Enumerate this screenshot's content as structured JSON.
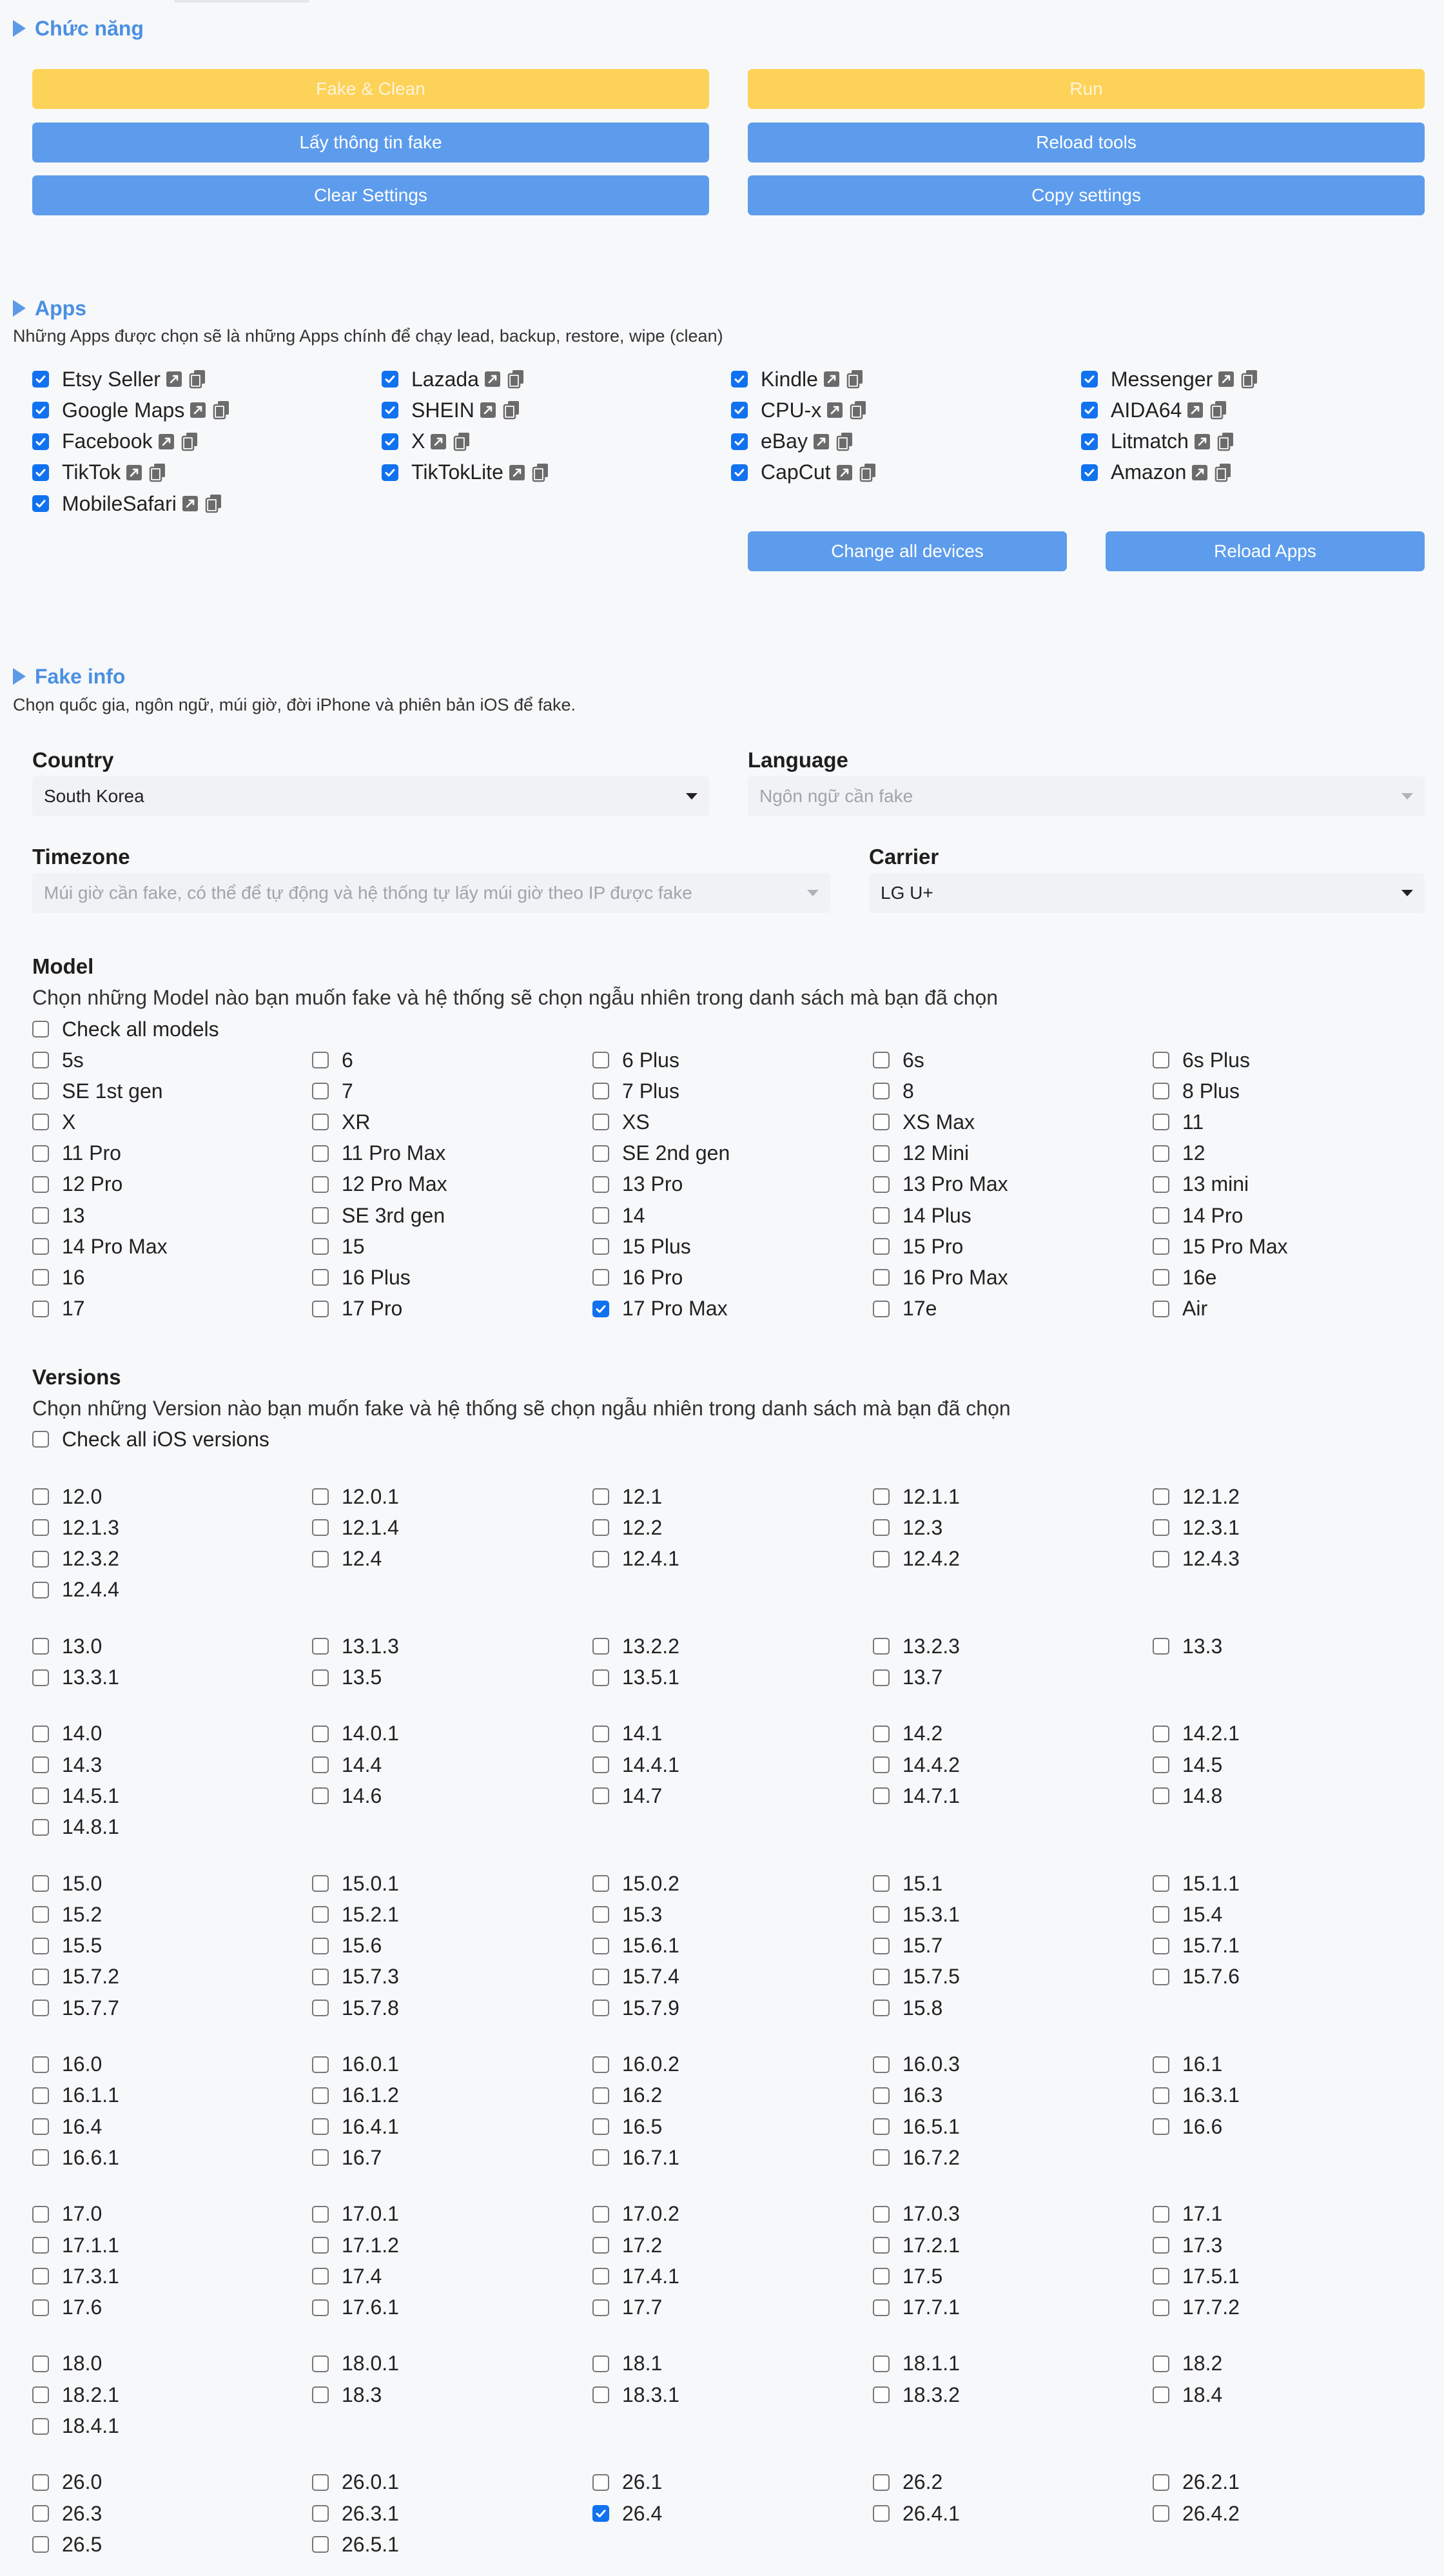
{
  "sections": {
    "functions": {
      "title": "Chức năng"
    },
    "apps": {
      "title": "Apps",
      "description": "Những Apps được chọn sẽ là những Apps chính để chạy lead, backup, restore, wipe (clean)"
    },
    "fake_info": {
      "title": "Fake info",
      "description": "Chọn quốc gia, ngôn ngữ, múi giờ, đời iPhone và phiên bản iOS để fake."
    }
  },
  "function_buttons": [
    [
      "Fake & Clean",
      "Run"
    ],
    [
      "Lấy thông tin fake",
      "Reload tools"
    ],
    [
      "Clear Settings",
      "Copy settings"
    ]
  ],
  "apps": [
    [
      {
        "name": "Etsy Seller",
        "checked": true
      },
      {
        "name": "Lazada",
        "checked": true
      },
      {
        "name": "Kindle",
        "checked": true
      },
      {
        "name": "Messenger",
        "checked": true
      }
    ],
    [
      {
        "name": "Google Maps",
        "checked": true
      },
      {
        "name": "SHEIN",
        "checked": true
      },
      {
        "name": "CPU-x",
        "checked": true
      },
      {
        "name": "AIDA64",
        "checked": true
      }
    ],
    [
      {
        "name": "Facebook",
        "checked": true
      },
      {
        "name": "X",
        "checked": true
      },
      {
        "name": "eBay",
        "checked": true
      },
      {
        "name": "Litmatch",
        "checked": true
      }
    ],
    [
      {
        "name": "TikTok",
        "checked": true
      },
      {
        "name": "TikTokLite",
        "checked": true
      },
      {
        "name": "CapCut",
        "checked": true
      },
      {
        "name": "Amazon",
        "checked": true
      }
    ],
    [
      {
        "name": "MobileSafari",
        "checked": true
      }
    ]
  ],
  "app_buttons": {
    "change_all": "Change all devices",
    "reload": "Reload Apps"
  },
  "fields": {
    "country": {
      "label": "Country",
      "value": "South Korea"
    },
    "language": {
      "label": "Language",
      "placeholder": "Ngôn ngữ cần fake"
    },
    "timezone": {
      "label": "Timezone",
      "placeholder": "Múi giờ cần fake, có thể để tự động và hệ thống tự lấy múi giờ theo IP được fake"
    },
    "carrier": {
      "label": "Carrier",
      "value": "LG U+"
    }
  },
  "models": {
    "title": "Model",
    "description": "Chọn những Model nào bạn muốn fake và hệ thống sẽ chọn ngẫu nhiên trong danh sách mà bạn đã chọn",
    "check_all": "Check all models",
    "items": [
      [
        "5s",
        "6",
        "6 Plus",
        "6s",
        "6s Plus"
      ],
      [
        "SE 1st gen",
        "7",
        "7 Plus",
        "8",
        "8 Plus"
      ],
      [
        "X",
        "XR",
        "XS",
        "XS Max",
        "11"
      ],
      [
        "11 Pro",
        "11 Pro Max",
        "SE 2nd gen",
        "12 Mini",
        "12"
      ],
      [
        "12 Pro",
        "12 Pro Max",
        "13 Pro",
        "13 Pro Max",
        "13 mini"
      ],
      [
        "13",
        "SE 3rd gen",
        "14",
        "14 Plus",
        "14 Pro"
      ],
      [
        "14 Pro Max",
        "15",
        "15 Plus",
        "15 Pro",
        "15 Pro Max"
      ],
      [
        "16",
        "16 Plus",
        "16 Pro",
        "16 Pro Max",
        "16e"
      ],
      [
        "17",
        "17 Pro",
        "17 Pro Max",
        "17e",
        "Air"
      ]
    ],
    "checked": [
      "17 Pro Max"
    ]
  },
  "versions": {
    "title": "Versions",
    "description": "Chọn những Version nào bạn muốn fake và hệ thống sẽ chọn ngẫu nhiên trong danh sách mà bạn đã chọn",
    "check_all": "Check all iOS versions",
    "groups": [
      [
        [
          "12.0",
          "12.0.1",
          "12.1",
          "12.1.1",
          "12.1.2"
        ],
        [
          "12.1.3",
          "12.1.4",
          "12.2",
          "12.3",
          "12.3.1"
        ],
        [
          "12.3.2",
          "12.4",
          "12.4.1",
          "12.4.2",
          "12.4.3"
        ],
        [
          "12.4.4"
        ]
      ],
      [
        [
          "13.0",
          "13.1.3",
          "13.2.2",
          "13.2.3",
          "13.3"
        ],
        [
          "13.3.1",
          "13.5",
          "13.5.1",
          "13.7"
        ]
      ],
      [
        [
          "14.0",
          "14.0.1",
          "14.1",
          "14.2",
          "14.2.1"
        ],
        [
          "14.3",
          "14.4",
          "14.4.1",
          "14.4.2",
          "14.5"
        ],
        [
          "14.5.1",
          "14.6",
          "14.7",
          "14.7.1",
          "14.8"
        ],
        [
          "14.8.1"
        ]
      ],
      [
        [
          "15.0",
          "15.0.1",
          "15.0.2",
          "15.1",
          "15.1.1"
        ],
        [
          "15.2",
          "15.2.1",
          "15.3",
          "15.3.1",
          "15.4"
        ],
        [
          "15.5",
          "15.6",
          "15.6.1",
          "15.7",
          "15.7.1"
        ],
        [
          "15.7.2",
          "15.7.3",
          "15.7.4",
          "15.7.5",
          "15.7.6"
        ],
        [
          "15.7.7",
          "15.7.8",
          "15.7.9",
          "15.8"
        ]
      ],
      [
        [
          "16.0",
          "16.0.1",
          "16.0.2",
          "16.0.3",
          "16.1"
        ],
        [
          "16.1.1",
          "16.1.2",
          "16.2",
          "16.3",
          "16.3.1"
        ],
        [
          "16.4",
          "16.4.1",
          "16.5",
          "16.5.1",
          "16.6"
        ],
        [
          "16.6.1",
          "16.7",
          "16.7.1",
          "16.7.2"
        ]
      ],
      [
        [
          "17.0",
          "17.0.1",
          "17.0.2",
          "17.0.3",
          "17.1"
        ],
        [
          "17.1.1",
          "17.1.2",
          "17.2",
          "17.2.1",
          "17.3"
        ],
        [
          "17.3.1",
          "17.4",
          "17.4.1",
          "17.5",
          "17.5.1"
        ],
        [
          "17.6",
          "17.6.1",
          "17.7",
          "17.7.1",
          "17.7.2"
        ]
      ],
      [
        [
          "18.0",
          "18.0.1",
          "18.1",
          "18.1.1",
          "18.2"
        ],
        [
          "18.2.1",
          "18.3",
          "18.3.1",
          "18.3.2",
          "18.4"
        ],
        [
          "18.4.1"
        ]
      ],
      [
        [
          "26.0",
          "26.0.1",
          "26.1",
          "26.2",
          "26.2.1"
        ],
        [
          "26.3",
          "26.3.1",
          "26.4",
          "26.4.1",
          "26.4.2"
        ],
        [
          "26.5",
          "26.5.1"
        ]
      ]
    ],
    "checked": [
      "26.4"
    ]
  },
  "icons": {
    "app_link": "external-link-icon",
    "app_copy": "copy-icon",
    "dropdown": "chevron-down-icon",
    "section": "triangle-right-icon"
  },
  "colors": {
    "accent": "#4a90e2",
    "button_blue": "#5d9cec",
    "button_yellow": "#fdd258",
    "checkbox_checked": "#1172f0"
  }
}
